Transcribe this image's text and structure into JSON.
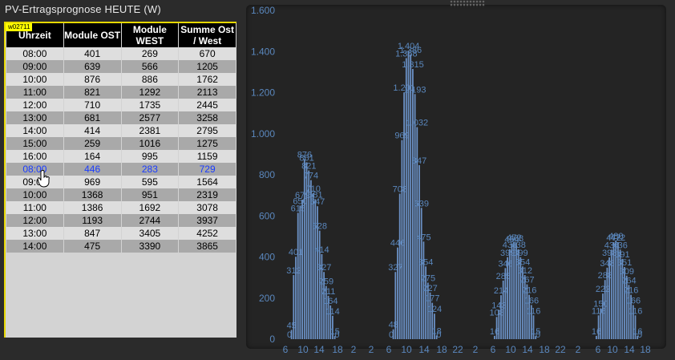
{
  "title": "PV-Ertragsprognose HEUTE (W)",
  "badge": "w02711",
  "table": {
    "headers": [
      "Uhrzeit",
      "Module OST",
      "Module WEST",
      "Summe Ost / West"
    ],
    "rows": [
      [
        "08:00",
        "401",
        "269",
        "670"
      ],
      [
        "09:00",
        "639",
        "566",
        "1205"
      ],
      [
        "10:00",
        "876",
        "886",
        "1762"
      ],
      [
        "11:00",
        "821",
        "1292",
        "2113"
      ],
      [
        "12:00",
        "710",
        "1735",
        "2445"
      ],
      [
        "13:00",
        "681",
        "2577",
        "3258"
      ],
      [
        "14:00",
        "414",
        "2381",
        "2795"
      ],
      [
        "15:00",
        "259",
        "1016",
        "1275"
      ],
      [
        "16:00",
        "164",
        "995",
        "1159"
      ],
      [
        "08:00",
        "446",
        "283",
        "729"
      ],
      [
        "09:00",
        "969",
        "595",
        "1564"
      ],
      [
        "10:00",
        "1368",
        "951",
        "2319"
      ],
      [
        "11:00",
        "1386",
        "1692",
        "3078"
      ],
      [
        "12:00",
        "1193",
        "2744",
        "3937"
      ],
      [
        "13:00",
        "847",
        "3405",
        "4252"
      ],
      [
        "14:00",
        "475",
        "3390",
        "3865"
      ]
    ],
    "highlight_row": 9
  },
  "colors": {
    "bar": "#6a90c4",
    "label": "#5a87bd",
    "panel": "#242424"
  },
  "chart_data": {
    "type": "bar",
    "ylim": [
      0,
      1600
    ],
    "yticks": [
      "0",
      "200",
      "400",
      "600",
      "800",
      "1.000",
      "1.200",
      "1.400",
      "1.600"
    ],
    "xticks": [
      "6",
      "10",
      "14",
      "18",
      "2",
      "2",
      "6",
      "10",
      "14",
      "18",
      "22",
      "2",
      "6",
      "10",
      "14",
      "18",
      "22",
      "2",
      "6",
      "10",
      "14",
      "18"
    ],
    "groups": [
      {
        "values": [
          0,
          45,
          312,
          401,
          615,
          650,
          679,
          876,
          861,
          821,
          774,
          710,
          681,
          647,
          528,
          414,
          327,
          259,
          211,
          164,
          114,
          15,
          0
        ],
        "labels": [
          "0",
          "45",
          "312",
          "401",
          "615",
          "650",
          "679",
          "876",
          "861",
          "821",
          "774",
          "710",
          "681",
          "647",
          "528",
          "414",
          "327",
          "259",
          "211",
          "164",
          "114",
          "15",
          "0"
        ]
      },
      {
        "values": [
          0,
          48,
          327,
          446,
          708,
          969,
          1201,
          1368,
          1404,
          1386,
          1315,
          1193,
          1032,
          847,
          639,
          475,
          354,
          275,
          227,
          177,
          124,
          18,
          0
        ],
        "labels": [
          "0",
          "48",
          "327",
          "446",
          "708",
          "969",
          "1.201",
          "1.368",
          "1.404",
          "1.386",
          "1.315",
          "1.193",
          "1.032",
          "847",
          "639",
          "475",
          "354",
          "275",
          "227",
          "177",
          "124",
          "18",
          "0"
        ]
      },
      {
        "values": [
          16,
          108,
          143,
          214,
          285,
          346,
          399,
          438,
          464,
          472,
          468,
          438,
          399,
          354,
          312,
          267,
          216,
          166,
          116,
          15,
          0
        ],
        "labels": [
          "16",
          "108",
          "143",
          "214",
          "285",
          "346",
          "399",
          "438",
          "464",
          "472",
          "468",
          "438",
          "399",
          "354",
          "312",
          "267",
          "216",
          "166",
          "116",
          "15",
          "0"
        ]
      },
      {
        "values": [
          16,
          116,
          150,
          222,
          288,
          348,
          398,
          436,
          472,
          480,
          472,
          436,
          391,
          351,
          309,
          264,
          216,
          166,
          116,
          16,
          0
        ],
        "labels": [
          "16",
          "116",
          "150",
          "222",
          "288",
          "348",
          "398",
          "436",
          "472",
          "480",
          "472",
          "436",
          "391",
          "351",
          "309",
          "264",
          "216",
          "166",
          "116",
          "16",
          "0"
        ]
      }
    ]
  }
}
